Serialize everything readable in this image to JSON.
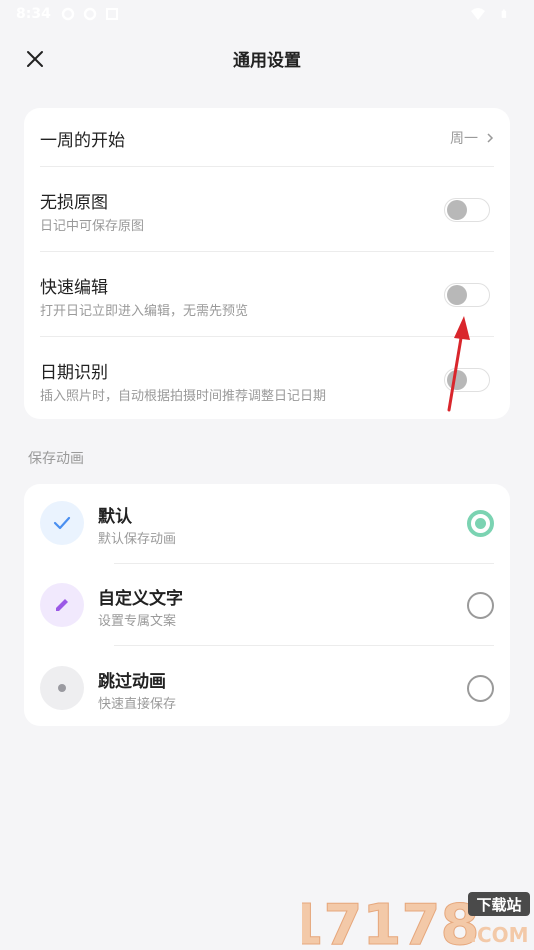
{
  "status_bar": {
    "time": "8:34",
    "left_icons": [
      "settings-icon",
      "settings-icon",
      "notification-icon"
    ],
    "right_icons": [
      "wifi-icon",
      "battery-icon"
    ]
  },
  "header": {
    "title": "通用设置",
    "close_icon": "close-icon"
  },
  "general": {
    "week_start": {
      "title": "一周的开始",
      "value": "周一"
    },
    "lossless": {
      "title": "无损原图",
      "subtitle": "日记中可保存原图",
      "enabled": false
    },
    "quick_edit": {
      "title": "快速编辑",
      "subtitle": "打开日记立即进入编辑，无需先预览",
      "enabled": false
    },
    "date_recognition": {
      "title": "日期识别",
      "subtitle": "插入照片时，自动根据拍摄时间推荐调整日记日期",
      "enabled": false
    }
  },
  "save_animation": {
    "section_label": "保存动画",
    "options": [
      {
        "title": "默认",
        "subtitle": "默认保存动画",
        "icon": "check-icon",
        "selected": true
      },
      {
        "title": "自定义文字",
        "subtitle": "设置专属文案",
        "icon": "pencil-icon",
        "selected": false
      },
      {
        "title": "跳过动画",
        "subtitle": "快速直接保存",
        "icon": "dot-icon",
        "selected": false
      }
    ]
  },
  "colors": {
    "background": "#f5f5f7",
    "card": "#ffffff",
    "accent_green": "#7bd3b2",
    "annotation_red": "#d9262c"
  },
  "watermark": {
    "text_main": "17178",
    "badge": "下载站",
    "domain": ".COM"
  }
}
